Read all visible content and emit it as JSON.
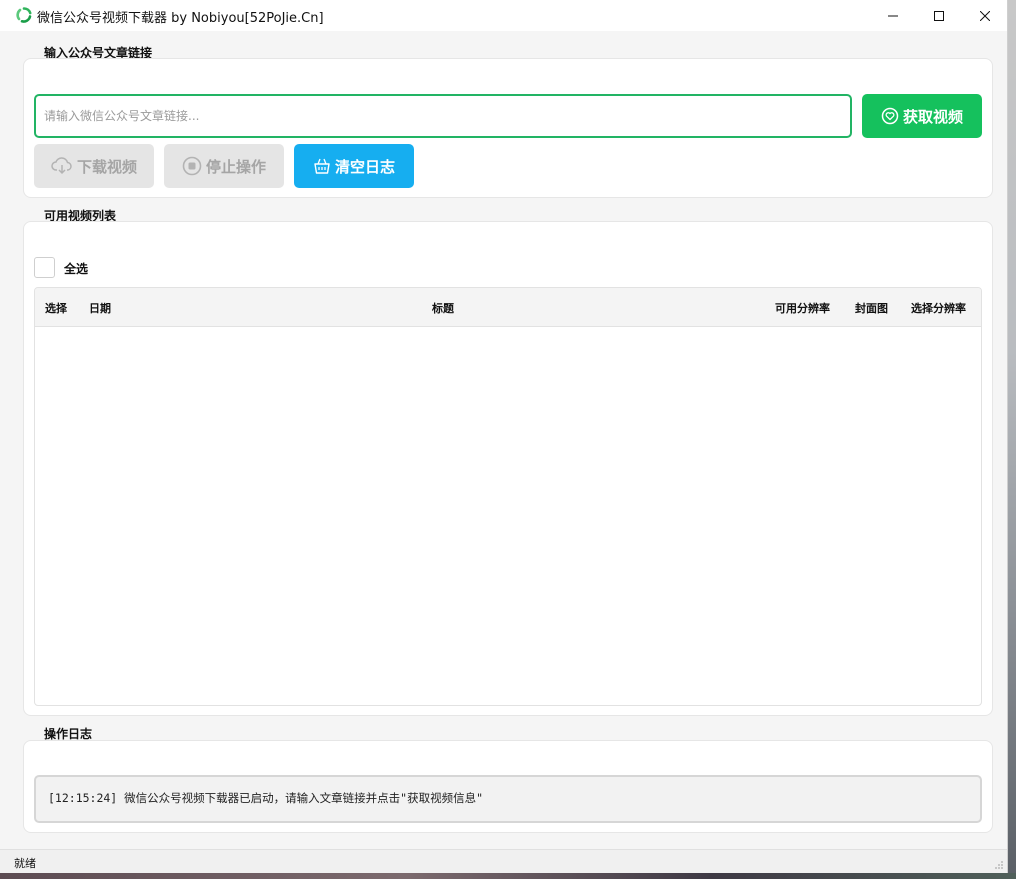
{
  "window": {
    "title": "微信公众号视频下载器 by Nobiyou[52PoJie.Cn]"
  },
  "input_section": {
    "label": "输入公众号文章链接",
    "url_placeholder": "请输入微信公众号文章链接...",
    "url_value": "",
    "get_button": "获取视频",
    "download_button": "下载视频",
    "stop_button": "停止操作",
    "clear_button": "清空日志"
  },
  "video_section": {
    "label": "可用视频列表",
    "select_all": "全选",
    "select_all_checked": false,
    "columns": [
      "选择",
      "日期",
      "标题",
      "可用分辨率",
      "封面图",
      "选择分辨率"
    ],
    "rows": []
  },
  "log_section": {
    "label": "操作日志",
    "entries": [
      "[12:15:24] 微信公众号视频下载器已启动，请输入文章链接并点击\"获取视频信息\""
    ]
  },
  "status": {
    "text": "就绪"
  },
  "colors": {
    "accent_green": "#15c15d",
    "accent_blue": "#16aef0",
    "disabled_gray": "#e5e5e5"
  }
}
